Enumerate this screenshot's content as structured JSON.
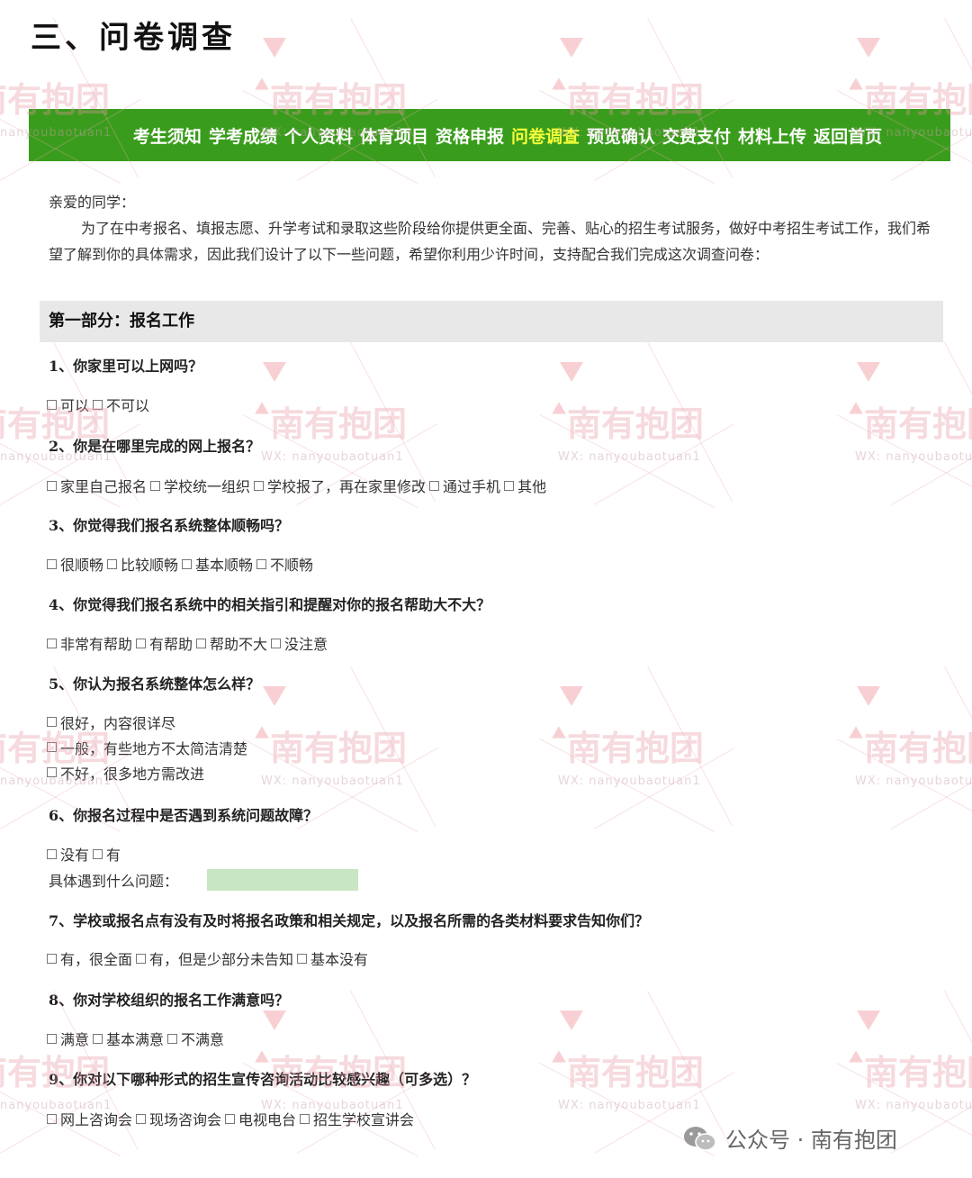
{
  "section_title": "三、问卷调查",
  "nav": {
    "items": [
      "考生须知",
      "学考成绩",
      "个人资料",
      "体育项目",
      "资格申报",
      "问卷调查",
      "预览确认",
      "交费支付",
      "材料上传",
      "返回首页"
    ],
    "active_index": 5,
    "bg_color": "#3a9c1c",
    "active_color": "#f5ff3a"
  },
  "intro": {
    "greeting": "亲爱的同学：",
    "body": "为了在中考报名、填报志愿、升学考试和录取这些阶段给你提供更全面、完善、贴心的招生考试服务，做好中考招生考试工作，我们希望了解到你的具体需求，因此我们设计了以下一些问题，希望你利用少许时间，支持配合我们完成这次调查问卷："
  },
  "part1": {
    "title": "第一部分：报名工作"
  },
  "questions": [
    {
      "text": "1、你家里可以上网吗？",
      "options": [
        "可以",
        "不可以"
      ]
    },
    {
      "text": "2、你是在哪里完成的网上报名？",
      "options": [
        "家里自己报名",
        "学校统一组织",
        "学校报了，再在家里修改",
        "通过手机",
        "其他"
      ]
    },
    {
      "text": "3、你觉得我们报名系统整体顺畅吗？",
      "options": [
        "很顺畅",
        "比较顺畅",
        "基本顺畅",
        "不顺畅"
      ]
    },
    {
      "text": "4、你觉得我们报名系统中的相关指引和提醒对你的报名帮助大不大？",
      "options": [
        "非常有帮助",
        "有帮助",
        "帮助不大",
        "没注意"
      ]
    },
    {
      "text": "5、你认为报名系统整体怎么样？",
      "options": [
        "很好，内容很详尽",
        "一般，有些地方不太简洁清楚",
        "不好，很多地方需改进"
      ]
    },
    {
      "text": "6、你报名过程中是否遇到系统问题故障？",
      "options": [
        "没有",
        "有"
      ],
      "fill_label": "具体遇到什么问题：",
      "fill_value": ""
    },
    {
      "text": "7、学校或报名点有没有及时将报名政策和相关规定，以及报名所需的各类材料要求告知你们？",
      "options": [
        "有，很全面",
        "有，但是少部分未告知",
        "基本没有"
      ]
    },
    {
      "text": "8、你对学校组织的报名工作满意吗？",
      "options": [
        "满意",
        "基本满意",
        "不满意"
      ]
    },
    {
      "text": "9、你对以下哪种形式的招生宣传咨询活动比较感兴趣（可多选）？",
      "options": [
        "网上咨询会",
        "现场咨询会",
        "电视电台",
        "招生学校宣讲会"
      ]
    }
  ],
  "watermark": {
    "main": "南有抱团",
    "sub": "WX: nanyoubaotuan1",
    "sub_left": "nanyoubaotuan1"
  },
  "wechat_badge": {
    "label": "公众号 · 南有抱团",
    "icon": "wechat-icon"
  }
}
